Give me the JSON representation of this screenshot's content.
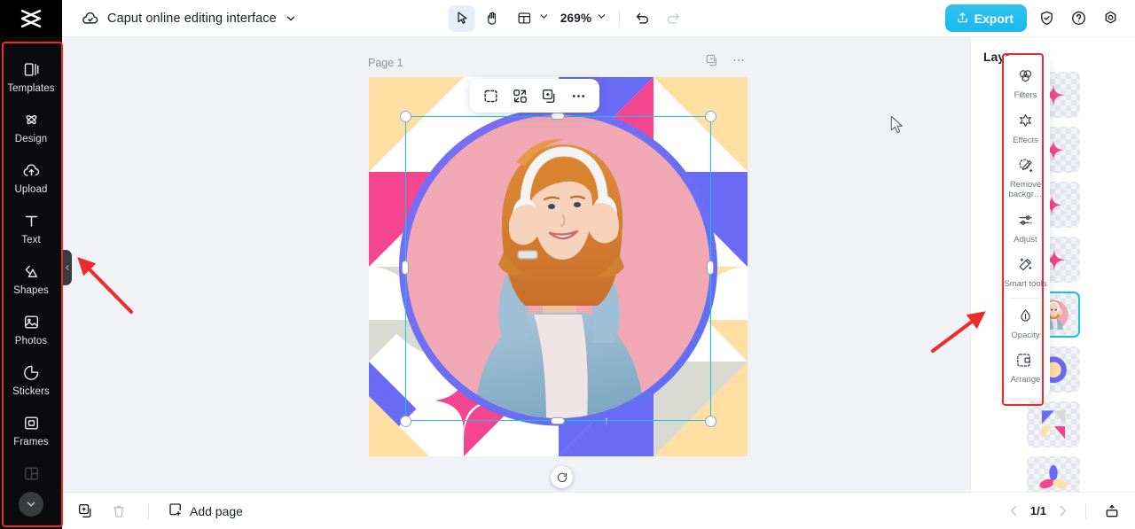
{
  "app": {
    "logo_icon": "capcut-logo-icon",
    "doc_title": "Caput online editing interface",
    "cloud_icon": "cloud-saved-icon",
    "title_chevron_icon": "chevron-down-icon"
  },
  "toolbar": {
    "select_tool": "cursor-select-icon",
    "hand_tool": "hand-pan-icon",
    "layout_tool": "page-layout-icon",
    "layout_chevron": "chevron-down-icon",
    "zoom_value": "269%",
    "zoom_chevron": "chevron-down-icon",
    "undo_icon": "undo-icon",
    "redo_icon": "redo-icon",
    "export_label": "Export",
    "export_icon": "upload-export-icon",
    "export_color": "#1fbced",
    "shield_icon": "shield-check-icon",
    "help_icon": "question-help-icon",
    "settings_icon": "gear-settings-icon"
  },
  "sidebar": {
    "items": [
      {
        "label": "Templates",
        "icon": "templates-icon"
      },
      {
        "label": "Design",
        "icon": "design-icon"
      },
      {
        "label": "Upload",
        "icon": "upload-cloud-icon"
      },
      {
        "label": "Text",
        "icon": "text-icon"
      },
      {
        "label": "Shapes",
        "icon": "shapes-icon"
      },
      {
        "label": "Photos",
        "icon": "photos-icon"
      },
      {
        "label": "Stickers",
        "icon": "stickers-icon"
      },
      {
        "label": "Frames",
        "icon": "frames-icon"
      }
    ],
    "expand_chevron_icon": "chevron-down-icon",
    "collapse_handle_icon": "chevron-left-icon"
  },
  "canvas": {
    "page_label": "Page 1",
    "duplicate_page_icon": "duplicate-page-icon",
    "more_page_icon": "more-dots-icon",
    "float_toolbar": [
      {
        "icon": "crop-select-icon"
      },
      {
        "icon": "replace-swap-icon"
      },
      {
        "icon": "duplicate-icon"
      },
      {
        "icon": "more-dots-icon"
      }
    ],
    "rotate_icon": "rotate-handle-icon",
    "cursor_icon": "mouse-pointer-icon",
    "selection_color": "#16c4e8",
    "palette": {
      "pink": "#f4458e",
      "blue": "#6a6bf5",
      "cream": "#ffdfa3",
      "grey": "#d9dad2",
      "white": "#ffffff",
      "rose": "#f0a8b4"
    }
  },
  "edit_panel": {
    "items": [
      {
        "label": "Filters",
        "icon": "filters-icon"
      },
      {
        "label": "Effects",
        "icon": "effects-star-icon"
      },
      {
        "label": "Remove backgr…",
        "icon": "remove-background-icon"
      },
      {
        "label": "Adjust",
        "icon": "adjust-sliders-icon"
      },
      {
        "label": "Smart tools",
        "icon": "smart-tools-wand-icon"
      },
      {
        "label": "Opacity",
        "icon": "opacity-drop-icon"
      },
      {
        "label": "Arrange",
        "icon": "arrange-icon"
      }
    ]
  },
  "layers": {
    "title": "Layers",
    "items": [
      {
        "type": "sparkle",
        "selected": false
      },
      {
        "type": "sparkle",
        "selected": false
      },
      {
        "type": "sparkle",
        "selected": false
      },
      {
        "type": "sparkle",
        "selected": false
      },
      {
        "type": "photo",
        "selected": true
      },
      {
        "type": "ring",
        "selected": false
      },
      {
        "type": "triangles",
        "selected": false
      },
      {
        "type": "petals",
        "selected": false
      }
    ]
  },
  "bottombar": {
    "duplicate_icon": "duplicate-page-icon",
    "delete_icon": "trash-icon",
    "add_page_label": "Add page",
    "add_page_icon": "add-page-icon",
    "prev_icon": "chevron-left-icon",
    "page_indicator": "1/1",
    "next_icon": "chevron-right-icon",
    "present_icon": "present-icon"
  },
  "annotations": {
    "highlight_color": "#ee2b2b",
    "arrow_left_target": "sidebar-collapse-handle",
    "arrow_right_target": "edit-panel"
  }
}
